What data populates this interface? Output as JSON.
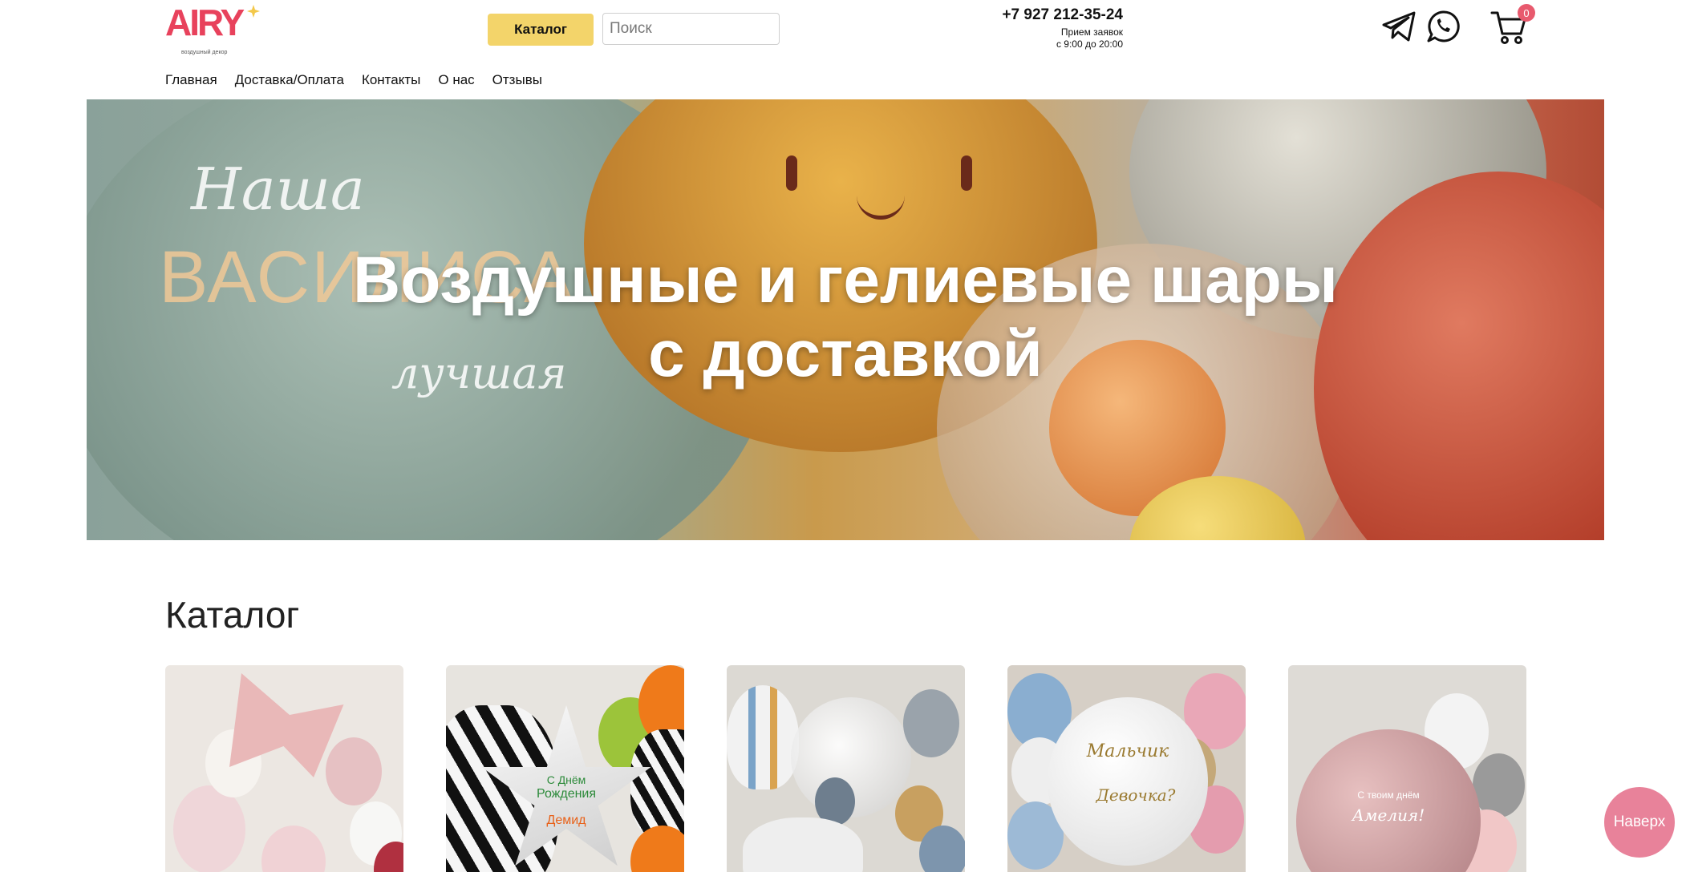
{
  "header": {
    "logo_text": "AIRY",
    "logo_tagline": "воздушный декор",
    "catalog_button": "Каталог",
    "search_placeholder": "Поиск",
    "phone": "+7 927 212-35-24",
    "hours_line1": "Прием заявок",
    "hours_line2": "с 9:00 до 20:00",
    "cart_count": "0"
  },
  "nav": {
    "items": [
      "Главная",
      "Доставка/Оплата",
      "Контакты",
      "О нас",
      "Отзывы"
    ]
  },
  "hero": {
    "title": "Воздушные и гелиевые шары с доставкой",
    "balloon_text_1": "Наша",
    "balloon_text_2": "ВАСИЛИСА",
    "balloon_text_3": "лучшая"
  },
  "catalog": {
    "title": "Каталог",
    "card2_text_1": "С Днём",
    "card2_text_2": "Рождения",
    "card2_text_3": "Демид",
    "card4_text_1": "Мальчик",
    "card4_text_2": "Девочка?",
    "card5_text_1": "С твоим днём",
    "card5_text_2": "Амелия!"
  },
  "up_button": "Наверх",
  "colors": {
    "accent_yellow": "#f3d46a",
    "logo_red": "#e8425c",
    "up_button_pink": "#e8829a"
  },
  "icons": [
    "telegram-icon",
    "whatsapp-icon",
    "cart-icon",
    "sparkle-icon"
  ]
}
